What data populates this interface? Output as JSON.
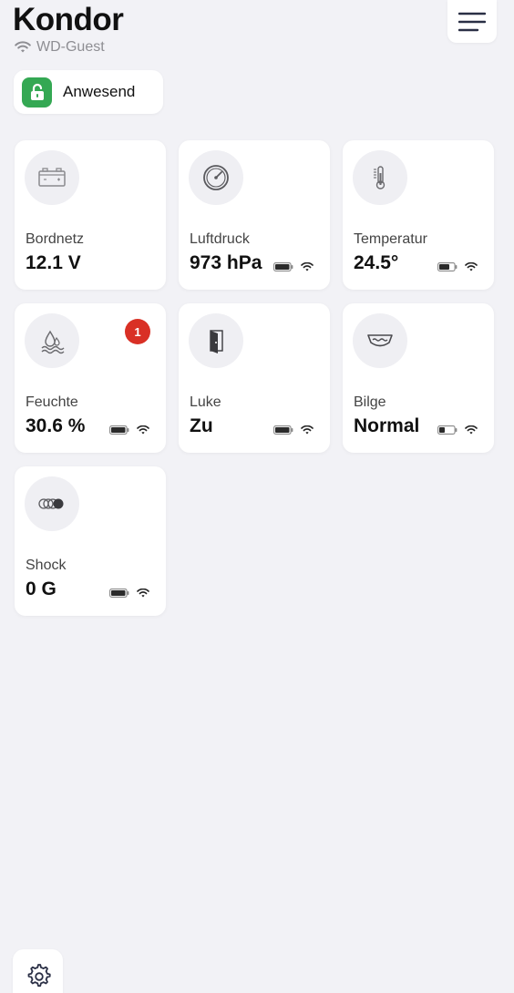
{
  "header": {
    "title": "Kondor",
    "network": "WD-Guest"
  },
  "presence": {
    "label": "Anwesend",
    "color": "#34a853"
  },
  "badge_color": "#d93025",
  "cards": [
    {
      "name": "Bordnetz",
      "value": "12.1 V",
      "icon": "battery-car-icon"
    },
    {
      "name": "Luftdruck",
      "value": "973 hPa",
      "icon": "gauge-icon"
    },
    {
      "name": "Temperatur",
      "value": "24.5°",
      "icon": "thermometer-icon"
    },
    {
      "name": "Feuchte",
      "value": "30.6 %",
      "icon": "water-drops-icon",
      "badge": "1"
    },
    {
      "name": "Luke",
      "value": "Zu",
      "icon": "door-icon"
    },
    {
      "name": "Bilge",
      "value": "Normal",
      "icon": "bilge-icon"
    },
    {
      "name": "Shock",
      "value": "0 G",
      "icon": "shock-rings-icon"
    }
  ]
}
